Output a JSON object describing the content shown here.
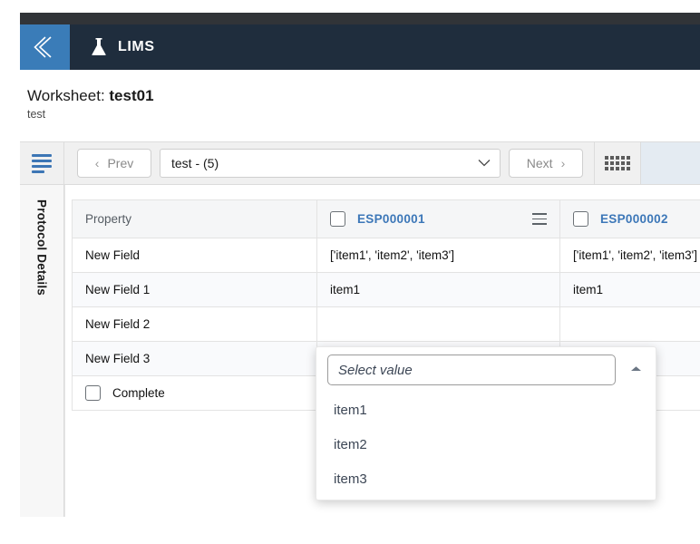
{
  "header": {
    "collapse_icon": "chevron-double-left-icon",
    "brand_icon": "flask-icon",
    "title": "LIMS"
  },
  "worksheet": {
    "label": "Worksheet: ",
    "name": "test01",
    "subtitle": "test"
  },
  "toolbar": {
    "menu_icon": "hamburger-icon",
    "prev_label": "Prev",
    "prev_icon": "chevron-left-icon",
    "next_label": "Next",
    "next_icon": "chevron-right-icon",
    "select_value": "test - (5)",
    "select_caret_icon": "chevron-down-icon",
    "grid_icon": "grid-dots-icon"
  },
  "side_tab": {
    "label": "Protocol Details"
  },
  "table": {
    "columns": [
      {
        "label": "Property",
        "type": "property"
      },
      {
        "label": "ESP000001",
        "type": "sample",
        "checkbox": false,
        "menu_icon": "row-menu-icon"
      },
      {
        "label": "ESP000002",
        "type": "sample",
        "checkbox": false,
        "menu_icon": "row-menu-icon"
      }
    ],
    "rows": [
      {
        "property": "New Field",
        "values": [
          "['item1', 'item2', 'item3']",
          "['item1', 'item2', 'item3']"
        ]
      },
      {
        "property": "New Field 1",
        "values": [
          "item1",
          "item1"
        ]
      },
      {
        "property": "New Field 2",
        "values": [
          "",
          ""
        ]
      },
      {
        "property": "New Field 3",
        "values": [
          "",
          ""
        ]
      }
    ],
    "complete_row": {
      "label": "Complete",
      "checked": false
    }
  },
  "dropdown": {
    "placeholder": "Select value",
    "caret_icon": "chevron-up-icon",
    "options": [
      "item1",
      "item2",
      "item3"
    ]
  },
  "colors": {
    "header_bg": "#1f2d3d",
    "collapse_bg": "#3a7cb8",
    "accent_link": "#3c77b8",
    "toolbar_bg": "#f0f0f0"
  }
}
